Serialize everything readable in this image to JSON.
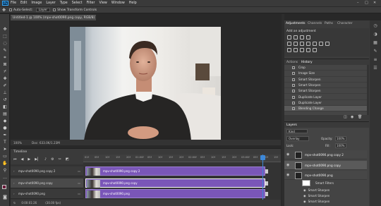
{
  "app": {
    "logo": "Ps"
  },
  "menu": [
    "File",
    "Edit",
    "Image",
    "Layer",
    "Type",
    "Select",
    "Filter",
    "View",
    "Window",
    "Help"
  ],
  "window_controls": [
    "–",
    "□",
    "✕"
  ],
  "options_bar": {
    "auto_select_label": "Auto-Select:",
    "auto_select_value": "Layer",
    "show_transform_label": "Show Transform Controls"
  },
  "document": {
    "tab_title": "Untitled-1 @ 100% (mpv-shot0090.png copy, RGB/8) *",
    "zoom": "100%",
    "doc_size": "Doc: 633.0K/1.23M"
  },
  "timeline": {
    "panel_title": "Timeline",
    "ticks": [
      "01f",
      "05f",
      "10f",
      "15f",
      "20f",
      "01:00f",
      "05f",
      "10f",
      "15f",
      "20f",
      "02:00f",
      "05f",
      "10f",
      "15f",
      "20f",
      "03:00f",
      "05f",
      "10f",
      "15f"
    ],
    "tracks": [
      {
        "label": "mpv-shot0090.png copy 2",
        "clip": "mpv-shot0090.png copy 2"
      },
      {
        "label": "mpv-shot0090.png copy",
        "clip": "mpv-shot0090.png copy"
      },
      {
        "label": "mpv-shot0090.png",
        "clip": "mpv-shot0090.png"
      }
    ],
    "current_time": "0:00:01:26",
    "fps": "(30.00 fps)"
  },
  "panels": {
    "adjust_tabs": [
      "Adjustments",
      "Channels",
      "Paths",
      "Character"
    ],
    "adjust_title": "Add an adjustment",
    "history_tabs": [
      "Actions",
      "History"
    ],
    "history_items": [
      "Crop",
      "Image Size",
      "Smart Sharpen",
      "Smart Sharpen",
      "Smart Sharpen",
      "Duplicate Layer",
      "Duplicate Layer",
      "Blending Change"
    ],
    "layers_tab": "Layers",
    "layers_kind": "Kind",
    "blend_mode": "Overlay",
    "opacity_label": "Opacity:",
    "opacity": "100%",
    "lock_label": "Lock:",
    "fill_label": "Fill:",
    "fill": "100%",
    "layers": [
      "mpv-shot0090.png copy 2",
      "mpv-shot0090.png copy",
      "mpv-shot0090.png"
    ],
    "sub_items": [
      "Smart Filters",
      "Smart Sharpen",
      "Smart Sharpen",
      "Smart Sharpen"
    ]
  }
}
